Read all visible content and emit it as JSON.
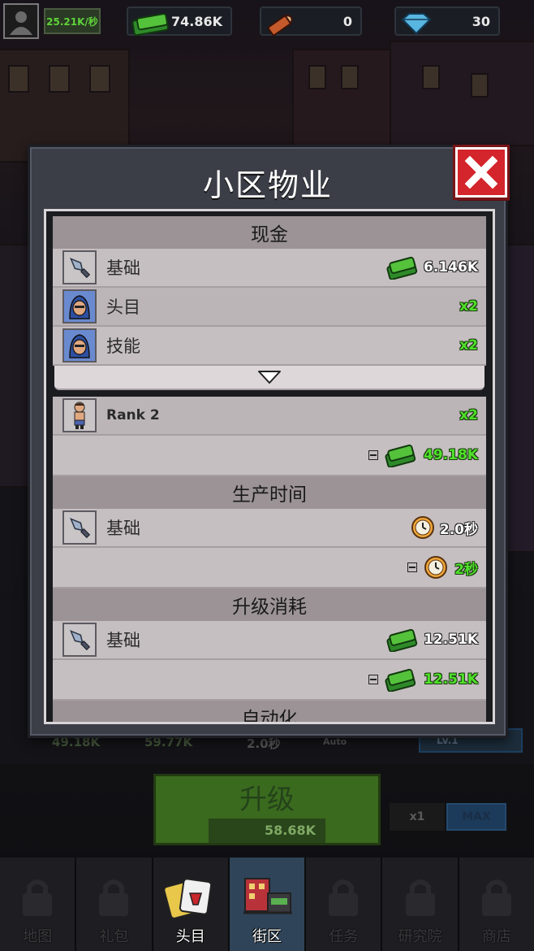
{
  "topbar": {
    "income_rate": "25.21K/秒",
    "cash": "74.86K",
    "ammo": "0",
    "gems": "30"
  },
  "modal": {
    "title": "小区物业",
    "sections": {
      "cash": {
        "header": "现金",
        "rows": [
          {
            "label": "基础",
            "value": "6.146K",
            "icon": "knife-icon"
          },
          {
            "label": "头目",
            "value": "x2",
            "icon": "boss-portrait-icon"
          },
          {
            "label": "技能",
            "value": "x2",
            "icon": "boss-portrait-icon"
          }
        ],
        "rank_row": {
          "label": "Rank 2",
          "value": "x2"
        },
        "total": "49.18K"
      },
      "time": {
        "header": "生产时间",
        "base_label": "基础",
        "base_value": "2.0秒",
        "total": "2秒"
      },
      "cost": {
        "header": "升级消耗",
        "base_label": "基础",
        "base_value": "12.51K",
        "total": "12.51K"
      },
      "auto": {
        "header": "自动化"
      }
    }
  },
  "behind": {
    "income": "49.18K",
    "income_next": "59.77K",
    "time": "2.0秒",
    "auto_label": "Auto",
    "level": "LV.1",
    "upgrade_label": "升级",
    "upgrade_cost": "58.68K",
    "mult_x1": "x1",
    "mult_max": "MAX"
  },
  "nav": [
    {
      "label": "地图",
      "active": false
    },
    {
      "label": "礼包",
      "active": false
    },
    {
      "label": "头目",
      "active": false
    },
    {
      "label": "街区",
      "active": true
    },
    {
      "label": "任务",
      "active": false
    },
    {
      "label": "研究院",
      "active": false
    },
    {
      "label": "商店",
      "active": false
    }
  ],
  "colors": {
    "green_value": "#4fe12a",
    "close_red": "#d3252b",
    "section_header": "#9b9395",
    "row_bg": "#c6bfc1"
  }
}
